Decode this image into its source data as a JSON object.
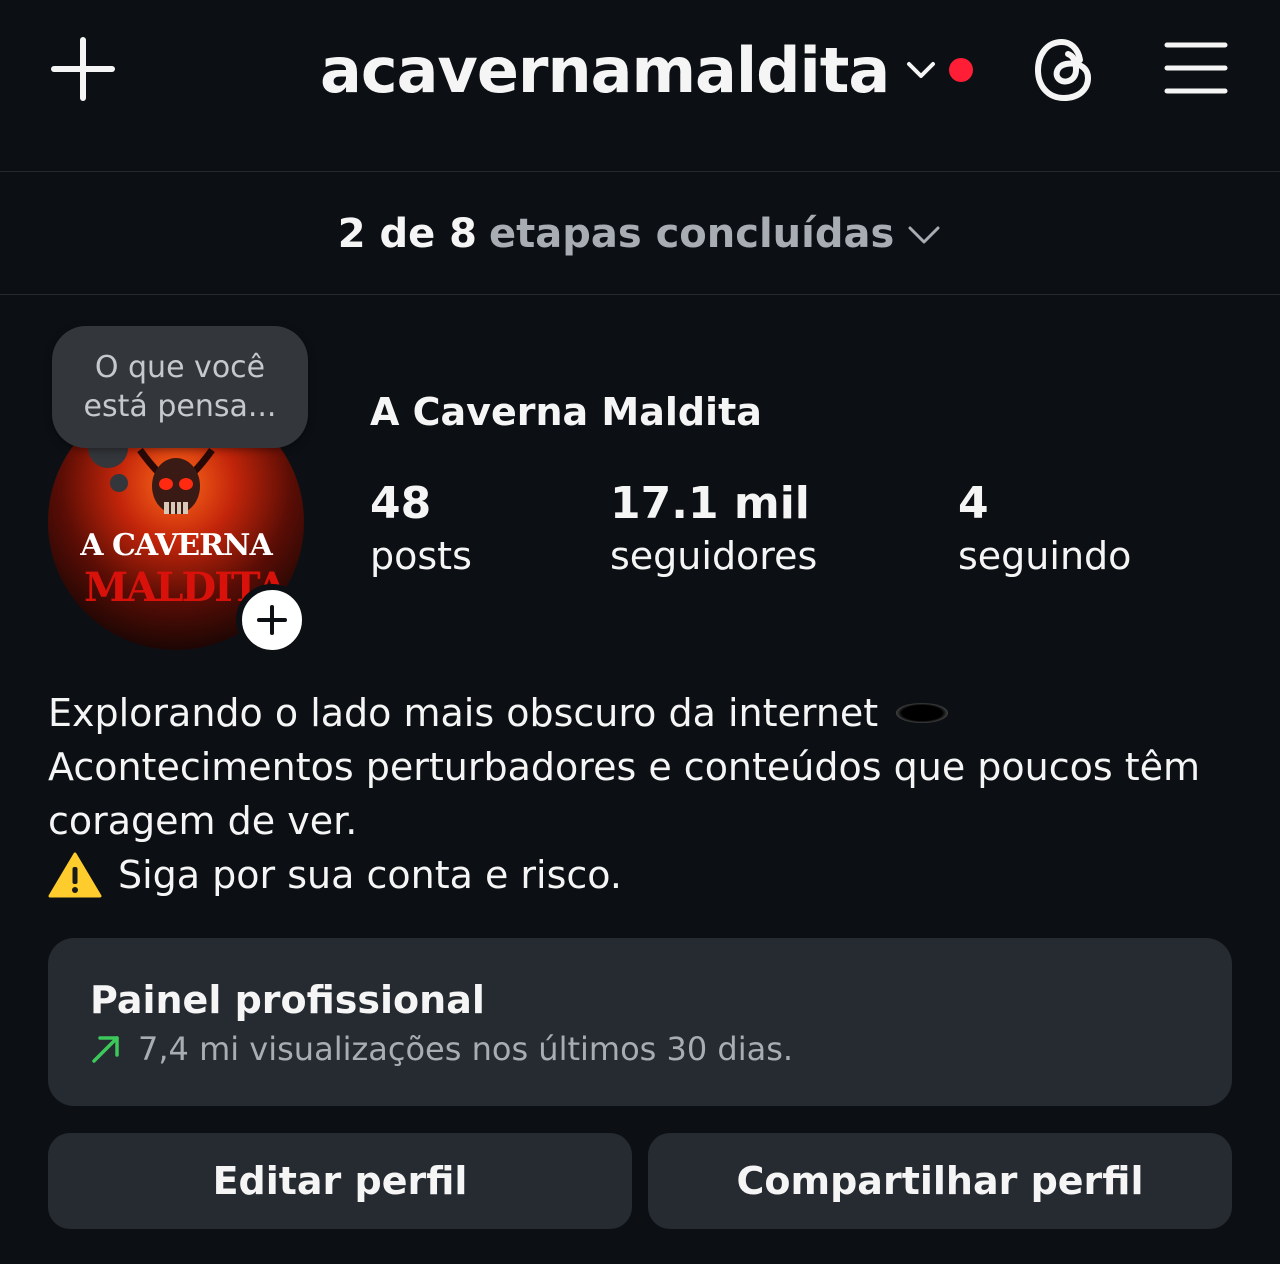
{
  "header": {
    "username": "acavernamaldita",
    "icons": [
      "plus-icon",
      "chevron-down-icon",
      "notification-dot",
      "threads-icon",
      "menu-icon"
    ],
    "notification_color": "#ff1e36"
  },
  "steps": {
    "strong": "2 de 8",
    "light": "etapas concluídas"
  },
  "profile": {
    "note_placeholder": "O que você está pensa...",
    "avatar_text_line1": "A CAVERNA",
    "avatar_text_line2": "MALDITA",
    "display_name": "A Caverna Maldita",
    "stats": [
      {
        "value": "48",
        "label": "posts"
      },
      {
        "value": "17.1 mil",
        "label": "seguidores"
      },
      {
        "value": "4",
        "label": "seguindo"
      }
    ]
  },
  "bio": {
    "line1": "Explorando o lado mais obscuro da internet",
    "line2": "Acontecimentos perturbadores e conteúdos que poucos têm coragem de ver.",
    "line3": "Siga por sua conta e risco."
  },
  "pro_panel": {
    "title": "Painel profissional",
    "subtitle": "7,4 mi visualizações nos últimos 30 dias.",
    "trend_color": "#3cc85a"
  },
  "actions": {
    "edit": "Editar perfil",
    "share": "Compartilhar perfil"
  }
}
